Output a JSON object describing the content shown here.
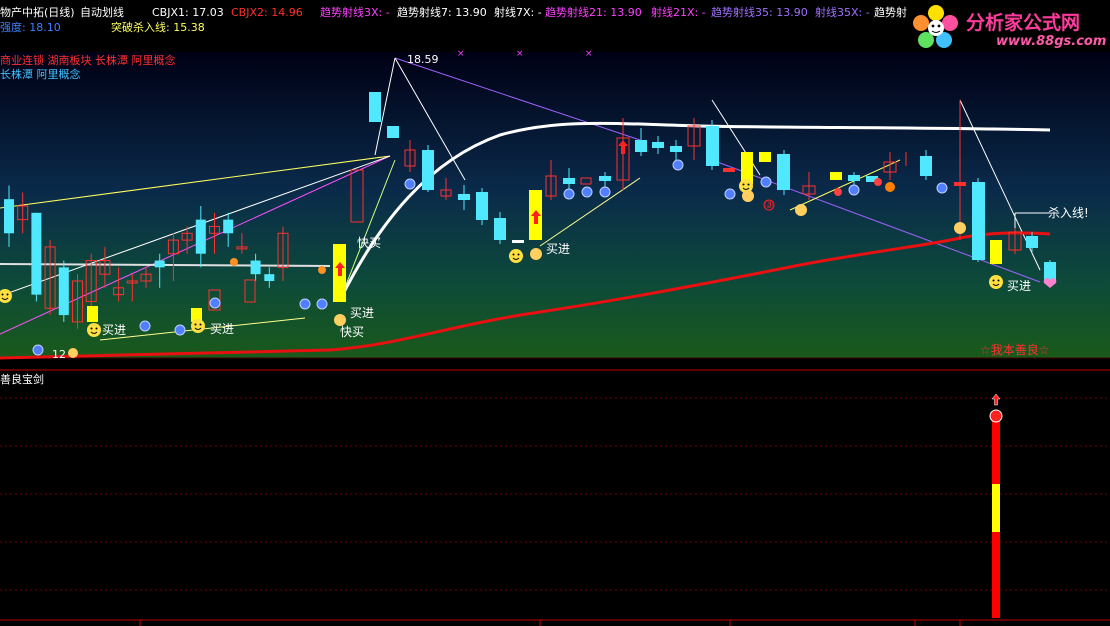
{
  "header": {
    "title": "物产中拓(日线)",
    "mode": "自动划线",
    "cbjx1": "CBJX1: 17.03",
    "cbjx2": "CBJX2: 14.96",
    "lines": [
      {
        "label": "趋势射线3X: -",
        "color": "#ff40ff"
      },
      {
        "label": "趋势射线7: 13.90",
        "color": "#ffffff"
      },
      {
        "label": "射线7X: -",
        "color": "#ffffff"
      },
      {
        "label": "趋势射线21: 13.90",
        "color": "#ff40ff"
      },
      {
        "label": "射线21X: -",
        "color": "#ff40ff"
      },
      {
        "label": "趋势射线35: 13.90",
        "color": "#a070ff"
      },
      {
        "label": "射线35X: -",
        "color": "#a070ff"
      },
      {
        "label": "趋势射",
        "color": "#ffffff"
      }
    ],
    "line2_left": "强度: 18.10",
    "breakout_line": "突破杀入线: 15.38"
  },
  "concepts": {
    "line1": "商业连锁 湖南板块 长株潭 阿里概念",
    "line2": "长株潭 阿里概念"
  },
  "logo": {
    "title": "分析家公式网",
    "url": "www.88gs.com"
  },
  "annotations": {
    "high_price": "18.59",
    "low_marker": "12",
    "buy": "买进",
    "quick_buy": "快买",
    "kill_line": "杀入线!",
    "signature": "☆我本善良☆",
    "circle_3": "③"
  },
  "lower_panel": {
    "title": "善良宝剑"
  },
  "colors": {
    "up": "#ff3030",
    "down": "#50e8ff",
    "yellow": "#ffff00",
    "ma_red": "#e81010",
    "ma_white": "#ffffff"
  },
  "chart_data": {
    "type": "candlestick",
    "series": [
      {
        "values": [
          {
            "o": 16.8,
            "h": 17.0,
            "l": 16.1,
            "c": 16.3
          },
          {
            "o": 16.5,
            "h": 16.9,
            "l": 16.3,
            "c": 16.7
          },
          {
            "o": 16.6,
            "h": 16.6,
            "l": 15.3,
            "c": 15.4
          },
          {
            "o": 15.2,
            "h": 16.2,
            "l": 15.1,
            "c": 16.1
          },
          {
            "o": 15.8,
            "h": 15.9,
            "l": 15.0,
            "c": 15.1
          },
          {
            "o": 15.0,
            "h": 15.7,
            "l": 14.9,
            "c": 15.6
          },
          {
            "o": 15.3,
            "h": 16.0,
            "l": 15.2,
            "c": 15.9
          },
          {
            "o": 15.7,
            "h": 16.1,
            "l": 15.5,
            "c": 15.9
          },
          {
            "o": 15.4,
            "h": 15.8,
            "l": 15.3,
            "c": 15.5
          },
          {
            "o": 15.6,
            "h": 15.7,
            "l": 15.3,
            "c": 15.6
          },
          {
            "o": 15.6,
            "h": 15.8,
            "l": 15.5,
            "c": 15.7
          },
          {
            "o": 15.9,
            "h": 16.0,
            "l": 15.5,
            "c": 15.8
          },
          {
            "o": 16.0,
            "h": 16.3,
            "l": 15.6,
            "c": 16.2
          },
          {
            "o": 16.2,
            "h": 16.4,
            "l": 16.0,
            "c": 16.3
          },
          {
            "o": 16.5,
            "h": 16.7,
            "l": 15.8,
            "c": 16.0
          },
          {
            "o": 16.3,
            "h": 16.6,
            "l": 16.0,
            "c": 16.4
          },
          {
            "o": 16.5,
            "h": 16.6,
            "l": 16.1,
            "c": 16.3
          },
          {
            "o": 16.1,
            "h": 16.3,
            "l": 16.0,
            "c": 16.1
          },
          {
            "o": 15.9,
            "h": 16.0,
            "l": 15.6,
            "c": 15.7
          },
          {
            "o": 15.7,
            "h": 15.8,
            "l": 15.5,
            "c": 15.6
          },
          {
            "o": 15.8,
            "h": 16.4,
            "l": 15.6,
            "c": 16.3
          },
          {
            "o": 16.4,
            "h": 16.9,
            "l": 16.2,
            "c": 16.8
          },
          {
            "o": 17.9,
            "h": 18.1,
            "l": 17.5,
            "c": 18.0
          },
          {
            "o": 17.1,
            "h": 17.2,
            "l": 16.8,
            "c": 16.9
          },
          {
            "o": 17.1,
            "h": 18.6,
            "l": 17.1,
            "c": 17.6
          }
        ]
      }
    ]
  }
}
